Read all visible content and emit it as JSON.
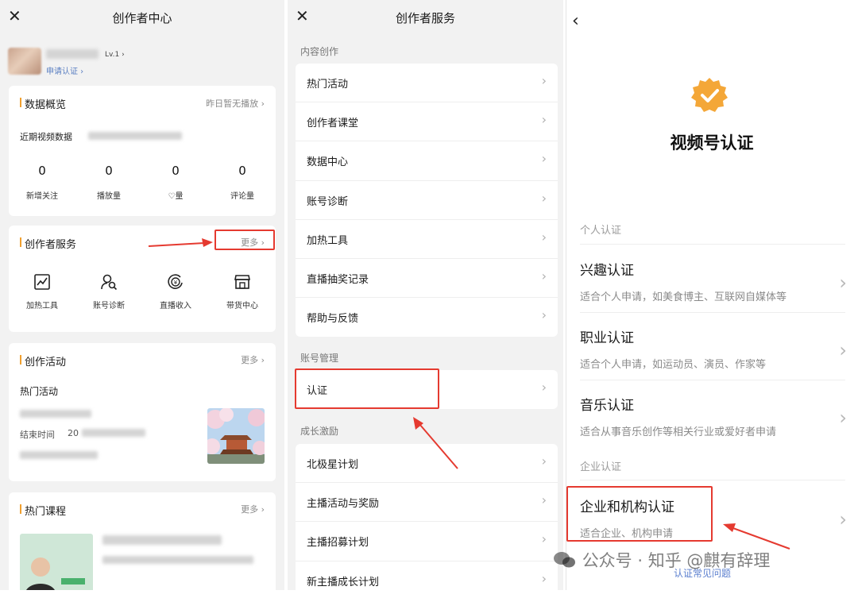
{
  "panel1": {
    "title": "创作者中心",
    "close_icon": "close-icon",
    "level": "Lv.1 ›",
    "apply_cert": "申请认证 ›",
    "data_overview": {
      "title": "数据概览",
      "right": "昨日暂无播放 ›",
      "recent": "近期视频数据",
      "stats": [
        {
          "value": "0",
          "label": "新增关注"
        },
        {
          "value": "0",
          "label": "播放量"
        },
        {
          "value": "0",
          "label": "♡量"
        },
        {
          "value": "0",
          "label": "评论量"
        }
      ]
    },
    "services": {
      "title": "创作者服务",
      "more": "更多 ›",
      "items": [
        {
          "label": "加热工具",
          "icon": "chart-icon"
        },
        {
          "label": "账号诊断",
          "icon": "user-search-icon"
        },
        {
          "label": "直播收入",
          "icon": "yuan-coin-icon"
        },
        {
          "label": "带货中心",
          "icon": "store-icon"
        }
      ]
    },
    "activity": {
      "title": "创作活动",
      "more": "更多 ›",
      "hot": "热门活动",
      "end_time": "结束时间",
      "year_prefix": "20"
    },
    "courses": {
      "title": "热门课程",
      "more": "更多 ›"
    }
  },
  "panel2": {
    "title": "创作者服务",
    "close_icon": "close-icon",
    "sections": [
      {
        "header": "内容创作",
        "items": [
          "热门活动",
          "创作者课堂",
          "数据中心",
          "账号诊断",
          "加热工具",
          "直播抽奖记录",
          "帮助与反馈"
        ]
      },
      {
        "header": "账号管理",
        "items": [
          "认证"
        ]
      },
      {
        "header": "成长激励",
        "items": [
          "北极星计划",
          "主播活动与奖励",
          "主播招募计划",
          "新主播成长计划"
        ]
      }
    ]
  },
  "panel3": {
    "back_icon": "back-icon",
    "badge_color": "#f4a738",
    "title": "视频号认证",
    "personal_header": "个人认证",
    "personal_items": [
      {
        "title": "兴趣认证",
        "desc": "适合个人申请，如美食博主、互联网自媒体等"
      },
      {
        "title": "职业认证",
        "desc": "适合个人申请，如运动员、演员、作家等"
      },
      {
        "title": "音乐认证",
        "desc": "适合从事音乐创作等相关行业或爱好者申请"
      }
    ],
    "org_header": "企业认证",
    "org_items": [
      {
        "title": "企业和机构认证",
        "desc": "适合企业、机构申请"
      }
    ],
    "faq": "认证常见问题"
  },
  "watermark": "公众号 · 知乎 @麒有辞理",
  "accent_color": "#e53a30"
}
